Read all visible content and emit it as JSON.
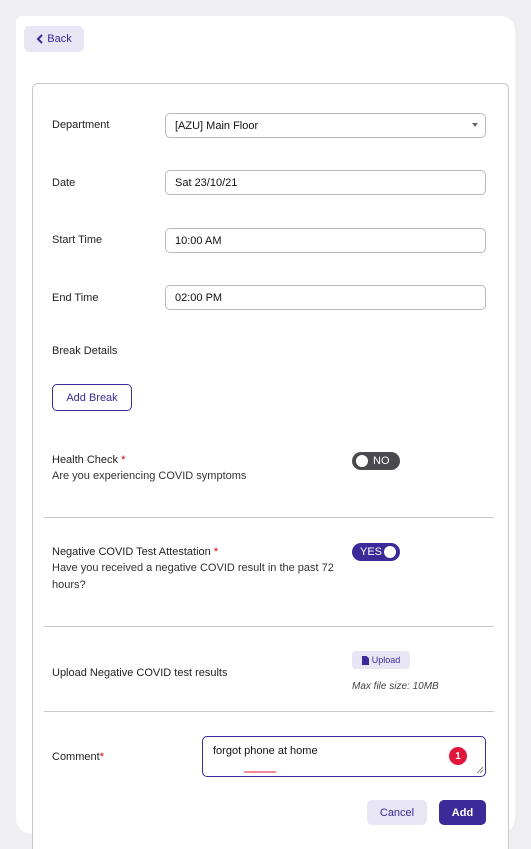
{
  "header": {
    "back_label": "Back"
  },
  "form": {
    "department": {
      "label": "Department",
      "value": "[AZU] Main Floor"
    },
    "date": {
      "label": "Date",
      "value": "Sat 23/10/21"
    },
    "start_time": {
      "label": "Start Time",
      "value": "10:00 AM"
    },
    "end_time": {
      "label": "End Time",
      "value": "02:00 PM"
    },
    "break_details": {
      "label": "Break Details",
      "button_label": "Add Break"
    },
    "health_check": {
      "label": "Health Check",
      "required_mark": "*",
      "question": "Are you experiencing COVID symptoms",
      "toggle_value": "NO"
    },
    "covid_attestation": {
      "label": "Negative COVID Test Attestation",
      "required_mark": "*",
      "question_line1": "Have you received a negative COVID result in the past 72",
      "question_line2": "hours?",
      "toggle_value": "YES"
    },
    "upload": {
      "label": "Upload Negative COVID test results",
      "button_label": "Upload",
      "max_size": "Max file size: 10MB"
    },
    "comment": {
      "label": "Comment",
      "required_mark": "*",
      "value": "forgot phone at home",
      "badge_count": "1"
    }
  },
  "actions": {
    "cancel_label": "Cancel",
    "add_label": "Add"
  },
  "colors": {
    "accent": "#3c2a98",
    "accent_light": "#e8e6f5",
    "error": "#e0173b",
    "toggle_off": "#4a4a4e"
  },
  "icons": {
    "back": "chevron-left-icon",
    "upload": "file-icon",
    "select": "caret-down-icon"
  }
}
